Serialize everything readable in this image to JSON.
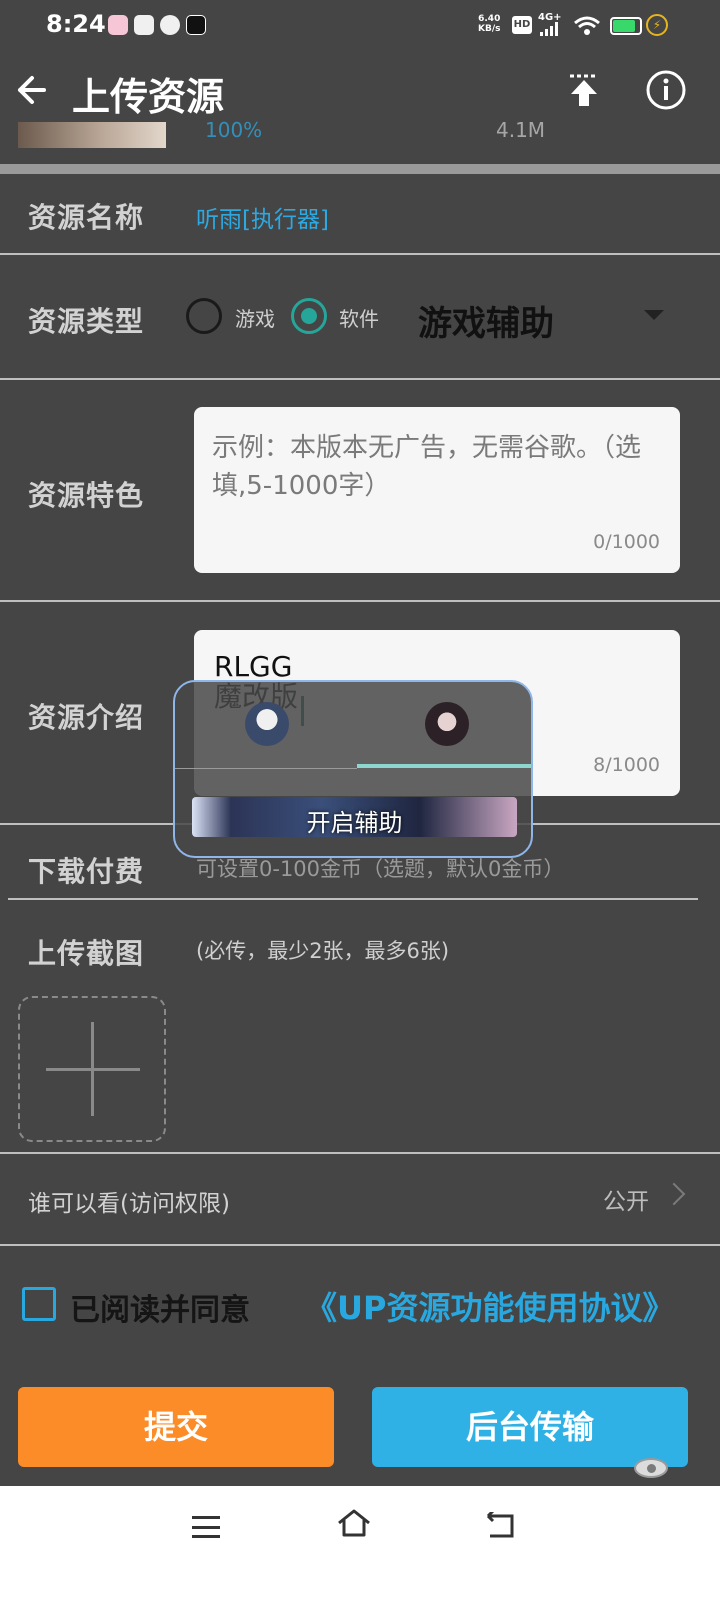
{
  "status_bar": {
    "time": "8:24",
    "net_speed_value": "6.40",
    "net_speed_unit": "KB/s",
    "hd": "HD",
    "network": "4G+"
  },
  "app_bar": {
    "title": "上传资源"
  },
  "upload_file": {
    "progress": "100%",
    "size": "4.1M"
  },
  "form": {
    "name_label": "资源名称",
    "name_value": "听雨[执行器]",
    "type_label": "资源类型",
    "type_options": [
      "游戏",
      "软件"
    ],
    "type_selected": "软件",
    "category_value": "游戏辅助",
    "features_label": "资源特色",
    "features_placeholder": "示例：本版本无广告，无需谷歌。（选填,5-1000字）",
    "features_counter": "0/1000",
    "intro_label": "资源介绍",
    "intro_value": "RLGG\n魔改版",
    "intro_counter": "8/1000",
    "fee_label": "下载付费",
    "fee_hint": "可设置0-100金币（选题，默认0金币）",
    "screenshot_label": "上传截图",
    "screenshot_hint": "(必传，最少2张，最多6张)",
    "visibility_label": "谁可以看(访问权限)",
    "visibility_value": "公开"
  },
  "overlay": {
    "banner_label": "开启辅助"
  },
  "agreement": {
    "label": "已阅读并同意",
    "link": "《UP资源功能使用协议》"
  },
  "actions": {
    "submit": "提交",
    "background_upload": "后台传输"
  }
}
